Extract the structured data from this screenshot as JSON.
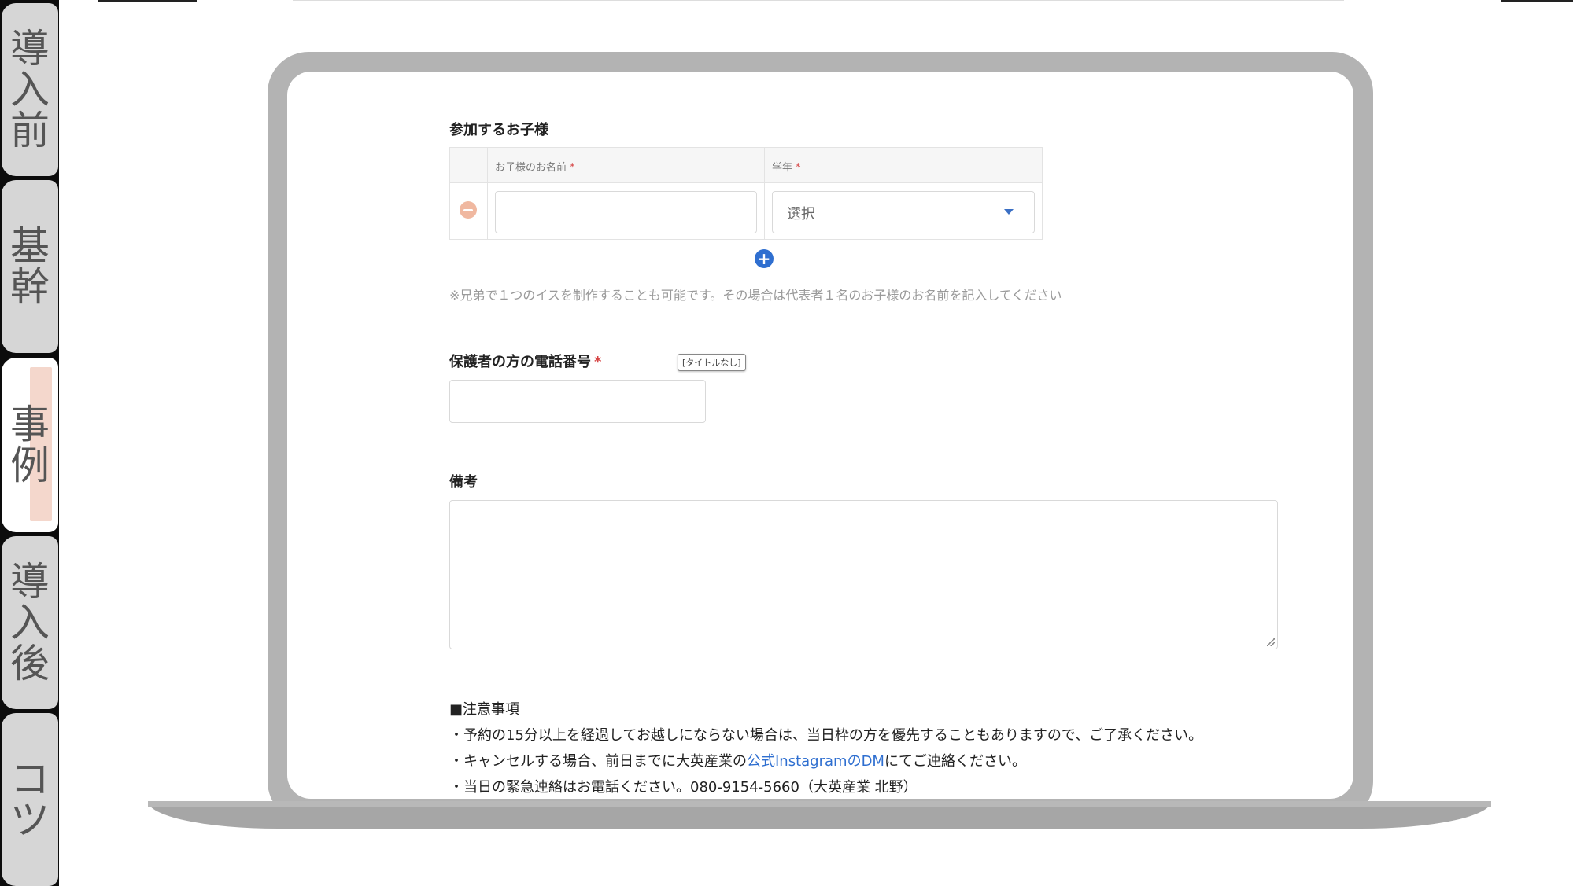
{
  "side_tabs": [
    {
      "label": "導入前",
      "chars": [
        "導",
        "入",
        "前"
      ],
      "active": false
    },
    {
      "label": "基幹",
      "chars": [
        "基",
        "幹"
      ],
      "active": false
    },
    {
      "label": "事例",
      "chars": [
        "事",
        "例"
      ],
      "active": true
    },
    {
      "label": "導入後",
      "chars": [
        "導",
        "入",
        "後"
      ],
      "active": false
    },
    {
      "label": "コツ",
      "chars": [
        "コ",
        "ツ"
      ],
      "active": false
    }
  ],
  "form": {
    "children_section": {
      "title": "参加するお子様",
      "col_name_header": "お子様のお名前",
      "col_grade_header": "学年",
      "required_mark": "*",
      "grade_select_value": "選択",
      "name_value": "",
      "add_icon": "plus-circle-icon",
      "remove_icon": "minus-circle-icon",
      "note": "※兄弟で１つのイスを制作することも可能です。その場合は代表者１名のお子様のお名前を記入してください"
    },
    "phone_section": {
      "title": "保護者の方の電話番号",
      "required_mark": "*",
      "value": "",
      "tooltip": "[タイトルなし]"
    },
    "remarks_section": {
      "title": "備考",
      "value": ""
    },
    "cautions": {
      "heading": "■注意事項",
      "line1": "・予約の15分以上を経過してお越しにならない場合は、当日枠の方を優先することもありますので、ご了承ください。",
      "line2_prefix": "・キャンセルする場合、前日までに大英産業の",
      "line2_link": "公式InstagramのDM",
      "line2_suffix": "にてご連絡ください。",
      "line3": "・当日の緊急連絡はお電話ください。080-9154-5660（大英産業 北野）"
    }
  },
  "colors": {
    "accent_blue": "#2f6fd0",
    "required_red": "#d64545",
    "laptop_gray": "#b3b3b3",
    "active_tab_highlight": "#f4d7cc"
  }
}
